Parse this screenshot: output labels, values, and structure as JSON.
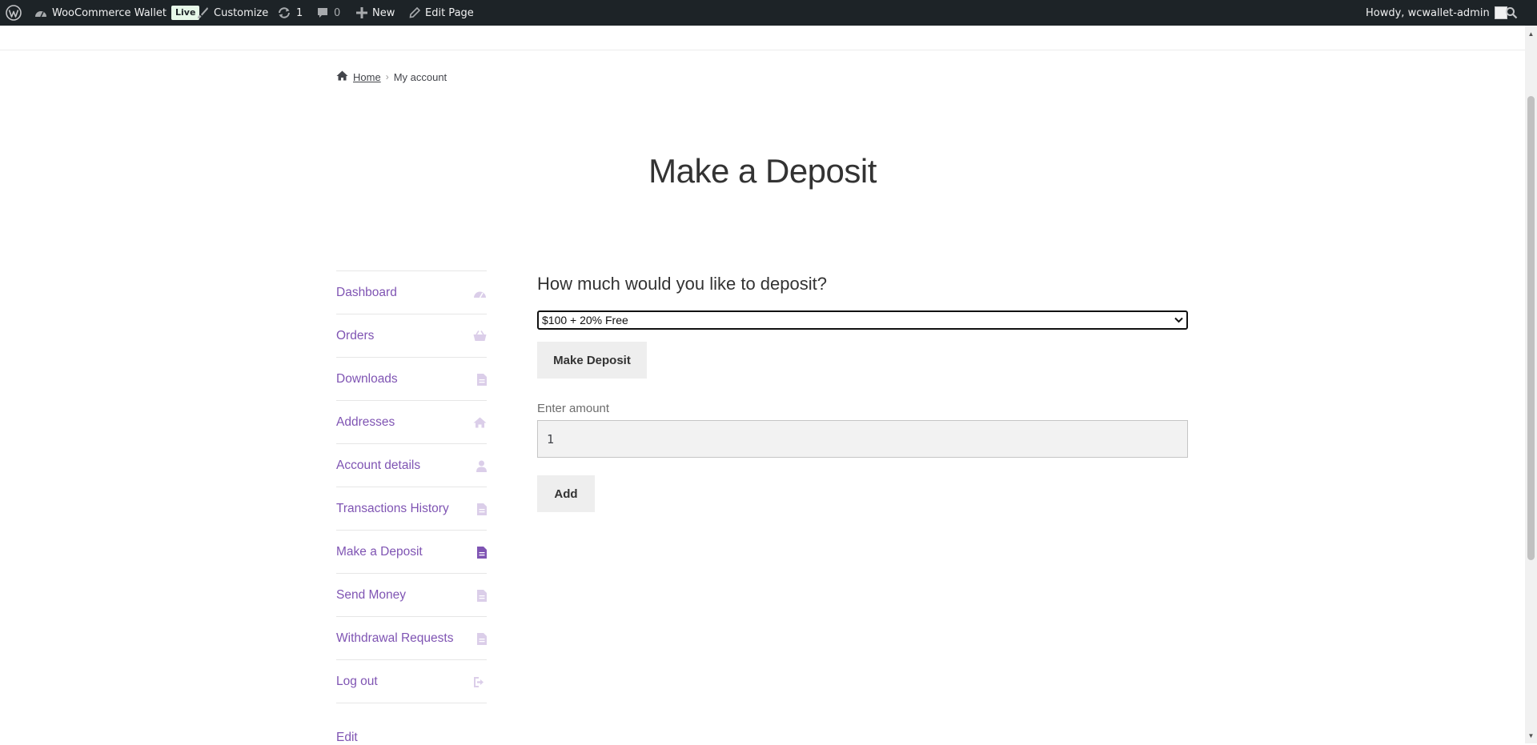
{
  "adminbar": {
    "site_name": "WooCommerce Wallet",
    "live_badge": "Live",
    "customize": "Customize",
    "updates_count": "1",
    "comments_count": "0",
    "new_label": "New",
    "edit_page": "Edit Page",
    "howdy": "Howdy, wcwallet-admin"
  },
  "breadcrumb": {
    "home": "Home",
    "separator": "›",
    "current": "My account"
  },
  "page_title": "Make a Deposit",
  "nav": {
    "items": [
      {
        "label": "Dashboard",
        "icon": "dashboard-icon"
      },
      {
        "label": "Orders",
        "icon": "basket-icon"
      },
      {
        "label": "Downloads",
        "icon": "file-icon"
      },
      {
        "label": "Addresses",
        "icon": "home-icon"
      },
      {
        "label": "Account details",
        "icon": "user-icon"
      },
      {
        "label": "Transactions History",
        "icon": "file-icon"
      },
      {
        "label": "Make a Deposit",
        "icon": "file-icon",
        "active": true
      },
      {
        "label": "Send Money",
        "icon": "file-icon"
      },
      {
        "label": "Withdrawal Requests",
        "icon": "file-icon"
      },
      {
        "label": "Log out",
        "icon": "sign-out-icon"
      }
    ],
    "edit": "Edit"
  },
  "deposit": {
    "heading": "How much would you like to deposit?",
    "selected_option": "$100 + 20% Free",
    "make_deposit_button": "Make Deposit",
    "amount_label": "Enter amount",
    "amount_value": "1",
    "add_button": "Add"
  },
  "colors": {
    "accent": "#7f54b3",
    "adminbar_bg": "#1d2327"
  }
}
